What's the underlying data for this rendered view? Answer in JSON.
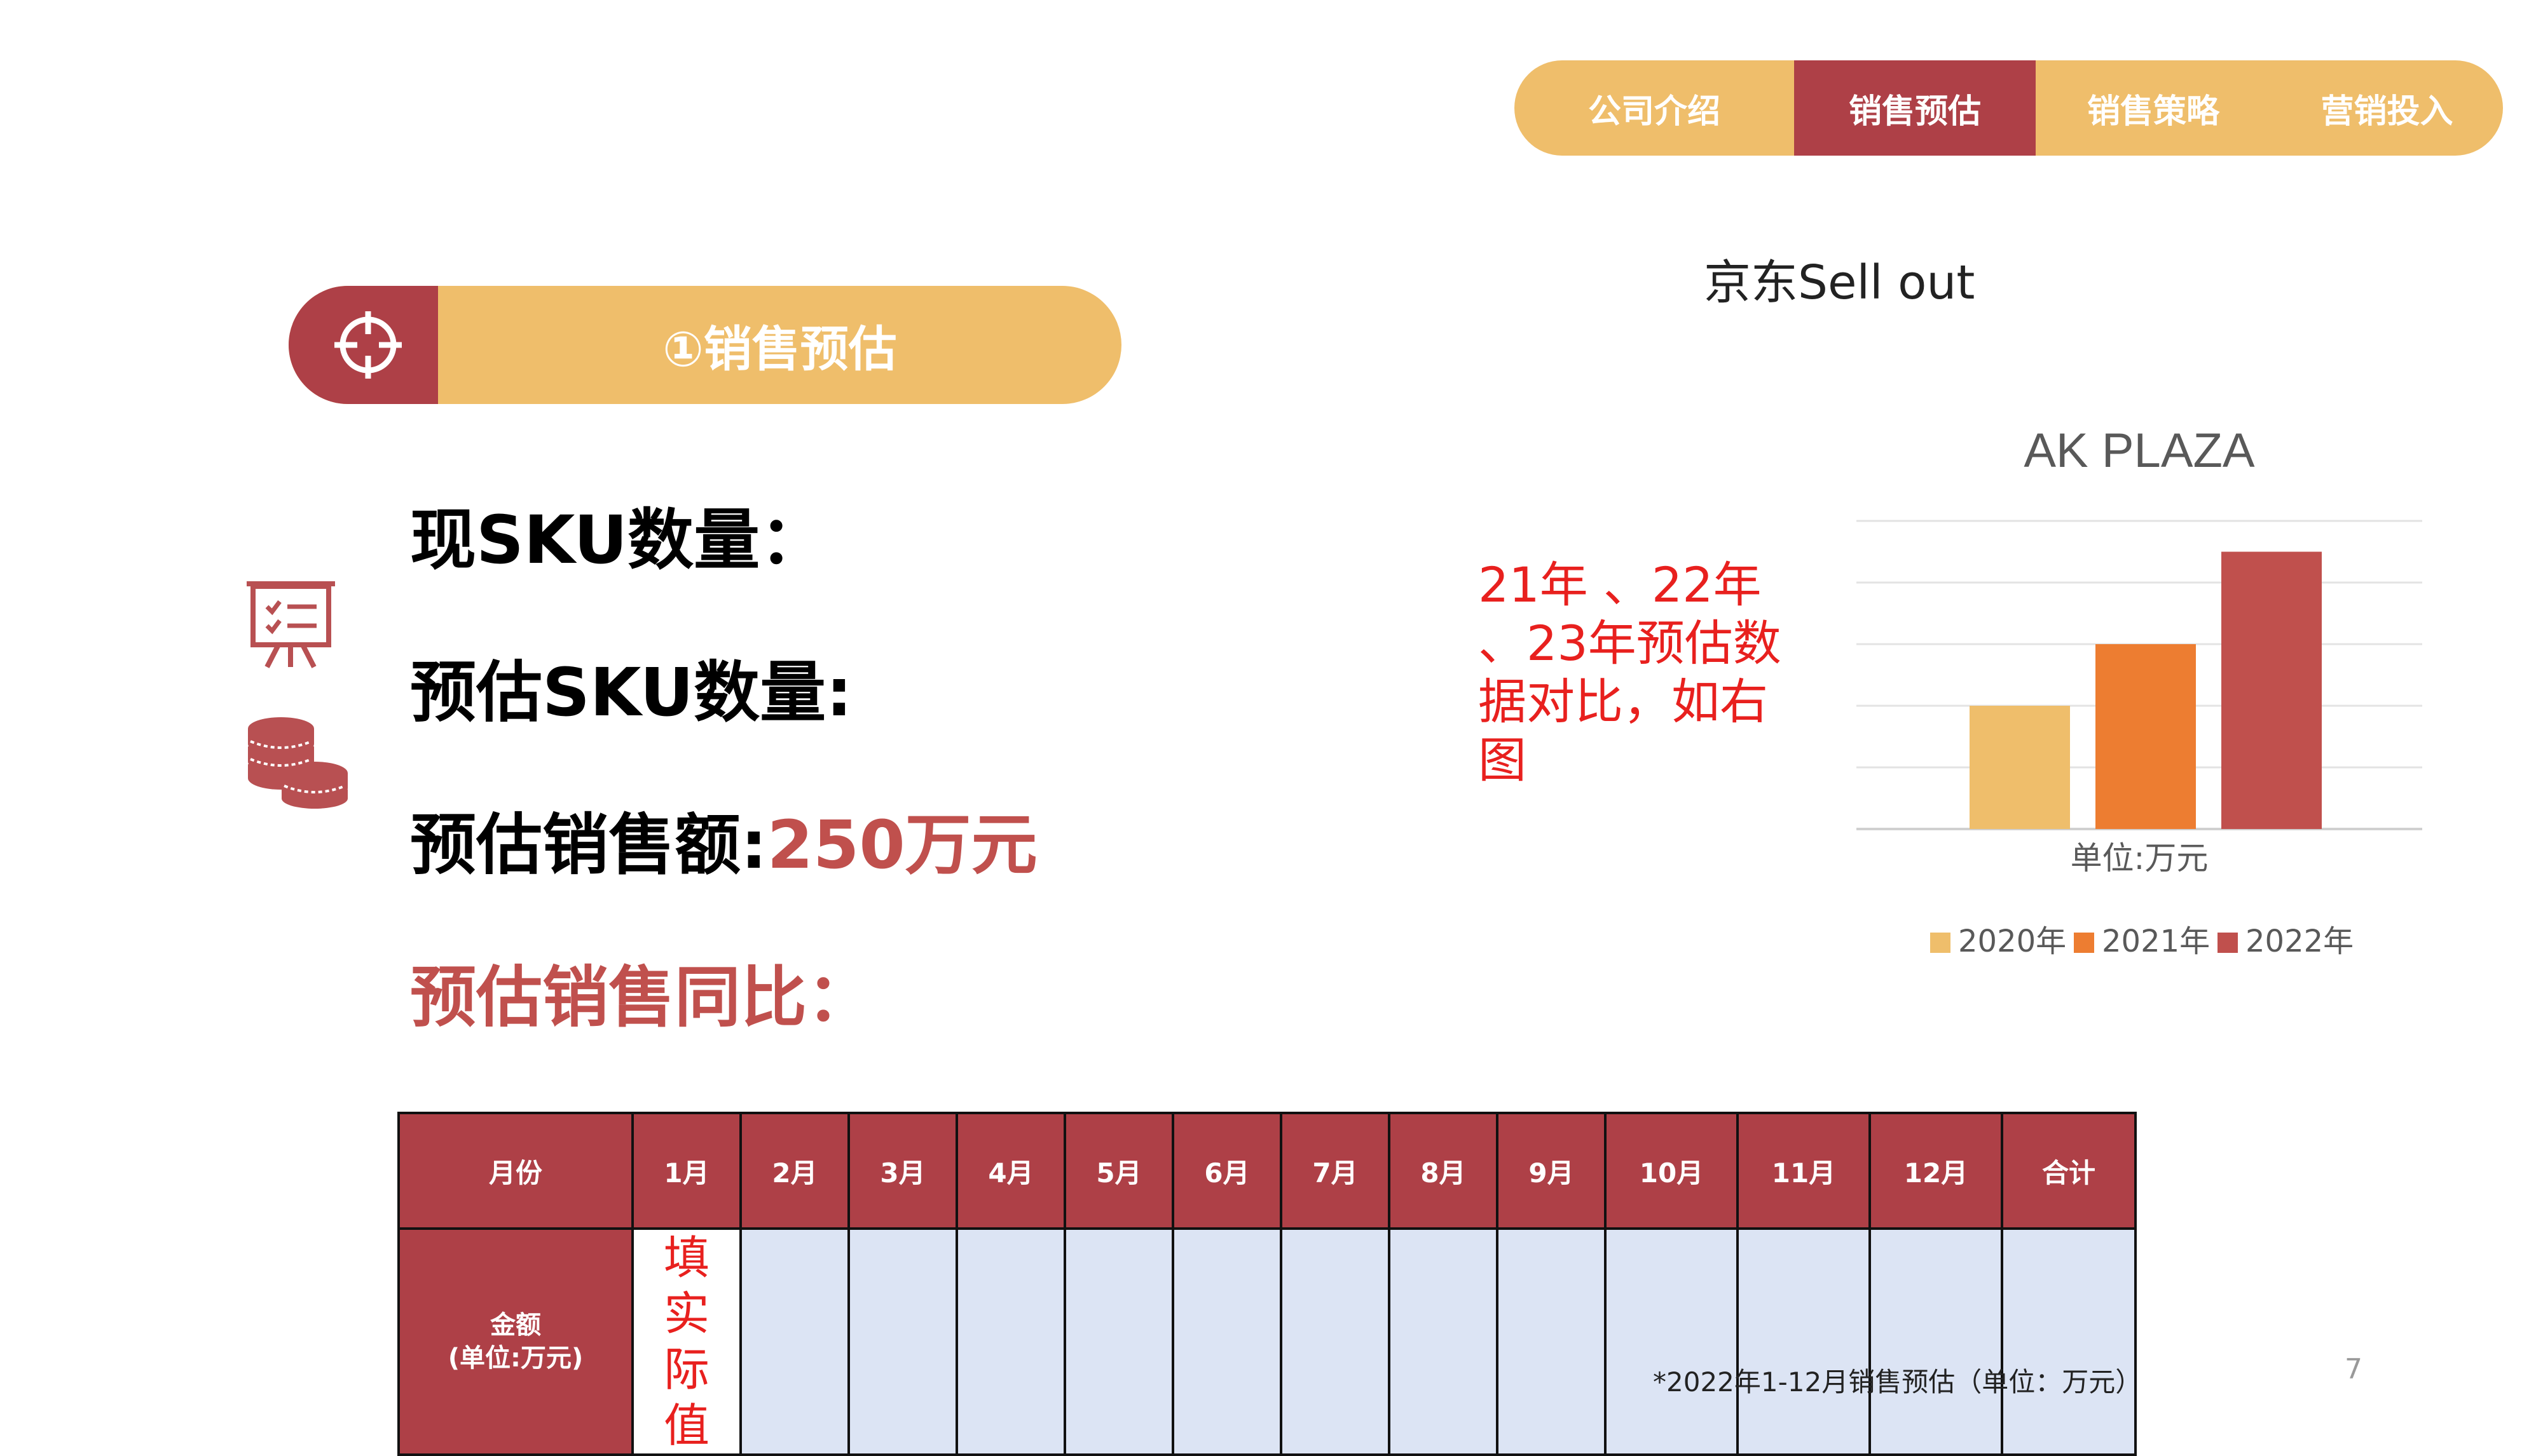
{
  "nav": {
    "tabs": [
      {
        "label": "公司介绍",
        "active": false
      },
      {
        "label": "销售预估",
        "active": true
      },
      {
        "label": "销售策略",
        "active": false
      },
      {
        "label": "营销投入",
        "active": false
      }
    ]
  },
  "section": {
    "title": "①销售预估",
    "icon": "crosshair-icon"
  },
  "metrics": {
    "sku_now": "现SKU数量：",
    "sku_est": "预估SKU数量:",
    "sales_label": "预估销售额:",
    "sales_value": "250万元",
    "yoy_label": "预估销售同比："
  },
  "jd_title": "京东Sell out",
  "note": "21年 、22年 、23年预估数据对比，如右图",
  "chart_data": {
    "type": "bar",
    "title": "AK PLAZA",
    "xlabel": "单位:万元",
    "categories": [
      "单位:万元"
    ],
    "series": [
      {
        "name": "2020年",
        "values": [
          2
        ],
        "color": "#EFBE6B"
      },
      {
        "name": "2021年",
        "values": [
          3
        ],
        "color": "#ED7D31"
      },
      {
        "name": "2022年",
        "values": [
          4.5
        ],
        "color": "#C0504D"
      }
    ],
    "ylim": [
      0,
      5
    ],
    "grid": true,
    "legend": "bottom"
  },
  "table": {
    "headers": [
      "月份",
      "1月",
      "2月",
      "3月",
      "4月",
      "5月",
      "6月",
      "7月",
      "8月",
      "9月",
      "10月",
      "11月",
      "12月",
      "合计"
    ],
    "row_label_line1": "金额",
    "row_label_line2": "(单位:万元)",
    "first_cell": "填实际值",
    "values": [
      "",
      "",
      "",
      "",
      "",
      "",
      "",
      "",
      "",
      "",
      "",
      ""
    ]
  },
  "footnote": "*2022年1-12月销售预估（单位：万元）",
  "page_number": "7",
  "colors": {
    "accent": "#AE4047",
    "gold": "#EFBE6B",
    "orange": "#ED7D31",
    "red_text": "#E8201E"
  }
}
